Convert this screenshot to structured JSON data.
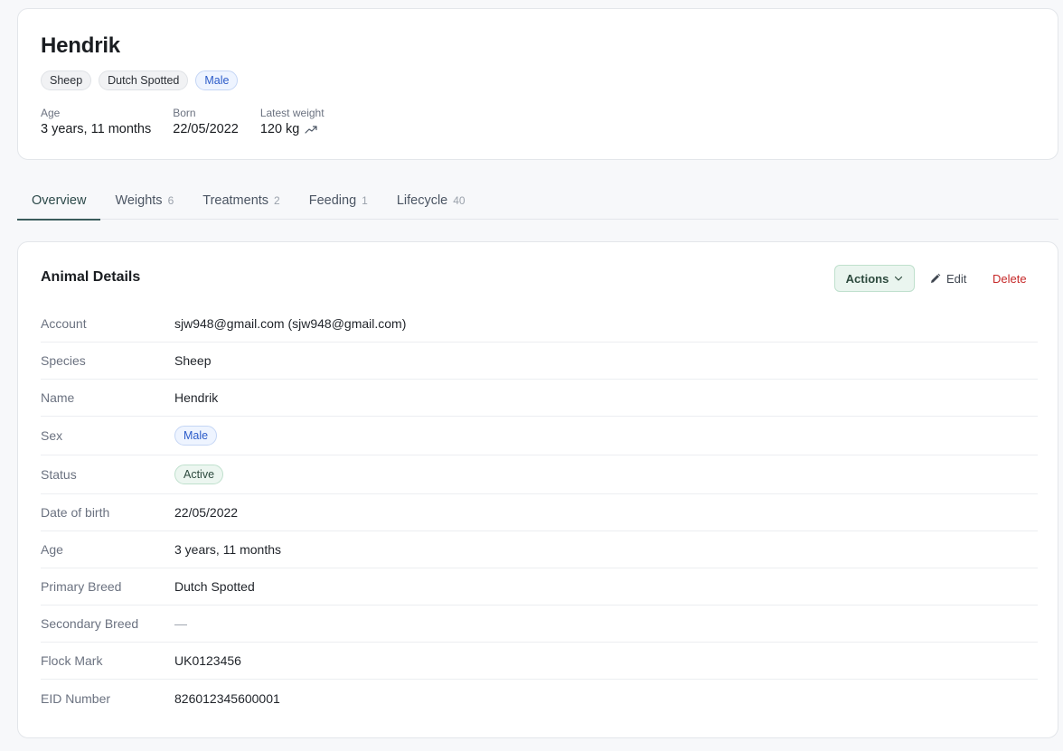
{
  "header": {
    "name": "Hendrik",
    "tags": [
      "Sheep",
      "Dutch Spotted",
      "Male"
    ],
    "stats": {
      "age_label": "Age",
      "age_value": "3 years, 11 months",
      "born_label": "Born",
      "born_value": "22/05/2022",
      "weight_label": "Latest weight",
      "weight_value": "120 kg"
    }
  },
  "tabs": [
    {
      "label": "Overview",
      "count": ""
    },
    {
      "label": "Weights",
      "count": "6"
    },
    {
      "label": "Treatments",
      "count": "2"
    },
    {
      "label": "Feeding",
      "count": "1"
    },
    {
      "label": "Lifecycle",
      "count": "40"
    }
  ],
  "details": {
    "title": "Animal Details",
    "actions_label": "Actions",
    "edit_label": "Edit",
    "delete_label": "Delete",
    "rows": [
      {
        "label": "Account",
        "value": "sjw948@gmail.com (sjw948@gmail.com)"
      },
      {
        "label": "Species",
        "value": "Sheep"
      },
      {
        "label": "Name",
        "value": "Hendrik"
      },
      {
        "label": "Sex",
        "value": "Male"
      },
      {
        "label": "Status",
        "value": "Active"
      },
      {
        "label": "Date of birth",
        "value": "22/05/2022"
      },
      {
        "label": "Age",
        "value": "3 years, 11 months"
      },
      {
        "label": "Primary Breed",
        "value": "Dutch Spotted"
      },
      {
        "label": "Secondary Breed",
        "value": "—"
      },
      {
        "label": "Flock Mark",
        "value": "UK0123456"
      },
      {
        "label": "EID Number",
        "value": "826012345600001"
      }
    ]
  },
  "colors": {
    "accent": "#3b5c5c",
    "male_badge": "#2b5bc9",
    "active_badge": "#2d4a3e",
    "delete": "#c62828"
  },
  "icons": {
    "weight_trend": "trending-up-icon",
    "actions": "chevron-down-icon",
    "edit": "pencil-icon"
  }
}
